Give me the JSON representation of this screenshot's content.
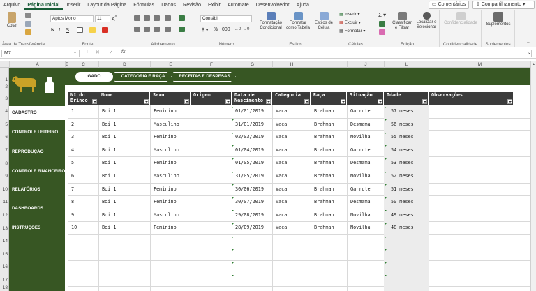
{
  "menu": [
    "Arquivo",
    "Página Inicial",
    "Inserir",
    "Layout da Página",
    "Fórmulas",
    "Dados",
    "Revisão",
    "Exibir",
    "Automate",
    "Desenvolvedor",
    "Ajuda"
  ],
  "topbar": {
    "comments": "Comentários",
    "share": "Compartilhamento"
  },
  "ribbon": {
    "clipboard": {
      "paste": "Colar",
      "label": "Área de Transferência"
    },
    "font": {
      "name": "Aptos Mono",
      "size": "11",
      "label": "Fonte"
    },
    "alignment": {
      "label": "Alinhamento"
    },
    "number": {
      "format": "Contábil",
      "label": "Número"
    },
    "styles": {
      "conditional": "Formatação Condicional",
      "table": "Formatar como Tabela",
      "cell": "Estilos de Célula",
      "label": "Estilos"
    },
    "cells": {
      "insert": "Inserir",
      "delete": "Excluir",
      "format": "Formatar",
      "label": "Células"
    },
    "editing": {
      "sort": "Classificar e Filtrar",
      "find": "Localizar e Selecionar",
      "label": "Edição"
    },
    "sensitivity": {
      "btn": "Confidencialidade",
      "label": "Confidencialidade"
    },
    "addins": {
      "btn": "Suplementos",
      "label": "Suplementos"
    }
  },
  "formula_bar": {
    "name_box": "M7",
    "fx": "fx"
  },
  "columns": [
    "A",
    "B",
    "C",
    "D",
    "E",
    "F",
    "G",
    "H",
    "I",
    "J",
    "L",
    "M"
  ],
  "rows": [
    "1",
    "2",
    "3",
    "4",
    "5",
    "6",
    "7",
    "8",
    "9",
    "10",
    "11",
    "12",
    "13",
    "14",
    "15",
    "16",
    "17",
    "18"
  ],
  "colors": {
    "green": "#375623",
    "header": "#3b3b3b",
    "gold": "#c9a227"
  },
  "sidebar": [
    "CADASTRO",
    "CONTROLE LEITEIRO",
    "REPRODUÇÃO",
    "CONTROLE FINANCEIRO",
    "RELATÓRIOS",
    "DASHBOARDS",
    "INSTRUÇÕES"
  ],
  "tabs": [
    "GADO",
    "CATEGORIA E RAÇA",
    "RECEITAS E DESPESAS"
  ],
  "table": {
    "headers": [
      "Nº do Brinco",
      "Nome",
      "Sexo",
      "Origem",
      "Data de Nascimento",
      "Categoria",
      "Raça",
      "Situação",
      "Idade",
      "Observações"
    ],
    "rows": [
      [
        "1",
        "Boi 1",
        "Feminino",
        "",
        "01/01/2019",
        "Vaca",
        "Brahman",
        "Garrote",
        "57 meses",
        ""
      ],
      [
        "2",
        "Boi 1",
        "Masculino",
        "",
        "31/01/2019",
        "Vaca",
        "Brahman",
        "Desmama",
        "56 meses",
        ""
      ],
      [
        "3",
        "Boi 1",
        "Feminino",
        "",
        "02/03/2019",
        "Vaca",
        "Brahman",
        "Novilha",
        "55 meses",
        ""
      ],
      [
        "4",
        "Boi 1",
        "Masculino",
        "",
        "01/04/2019",
        "Vaca",
        "Brahman",
        "Garrote",
        "54 meses",
        ""
      ],
      [
        "5",
        "Boi 1",
        "Feminino",
        "",
        "01/05/2019",
        "Vaca",
        "Brahman",
        "Desmama",
        "53 meses",
        ""
      ],
      [
        "6",
        "Boi 1",
        "Masculino",
        "",
        "31/05/2019",
        "Vaca",
        "Brahman",
        "Novilha",
        "52 meses",
        ""
      ],
      [
        "7",
        "Boi 1",
        "Feminino",
        "",
        "30/06/2019",
        "Vaca",
        "Brahman",
        "Garrote",
        "51 meses",
        ""
      ],
      [
        "8",
        "Boi 1",
        "Feminino",
        "",
        "30/07/2019",
        "Vaca",
        "Brahman",
        "Desmama",
        "50 meses",
        ""
      ],
      [
        "9",
        "Boi 1",
        "Masculino",
        "",
        "29/08/2019",
        "Vaca",
        "Brahman",
        "Novilha",
        "49 meses",
        ""
      ],
      [
        "10",
        "Boi 1",
        "Feminino",
        "",
        "28/09/2019",
        "Vaca",
        "Brahman",
        "Novilha",
        "48 meses",
        ""
      ]
    ]
  }
}
